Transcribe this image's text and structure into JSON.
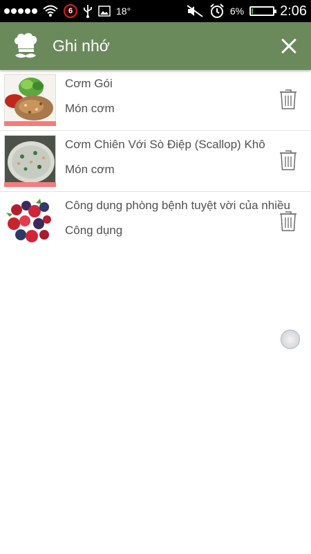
{
  "status_bar": {
    "notification_count": "6",
    "temperature": "18°",
    "battery_percent": "6%",
    "battery_level": 0.06,
    "time": "2:06"
  },
  "app_bar": {
    "title": "Ghi nhớ",
    "logo_icon": "chef-mustache-icon",
    "close_icon": "close-icon"
  },
  "colors": {
    "app_bar": "#6b8a5c",
    "thumb_bar": "#f47c7c",
    "text": "#505050"
  },
  "items": [
    {
      "title": "Cơm Gói",
      "subtitle": "Món cơm",
      "image": "rice-dish-photo",
      "has_bar": true
    },
    {
      "title": "Cơm Chiên Với Sò Điệp (Scallop) Khô",
      "subtitle": "Món cơm",
      "image": "fried-rice-photo",
      "has_bar": true
    },
    {
      "title": "Công dụng phòng bệnh tuyệt vời của nhiều",
      "subtitle": "Công dụng",
      "image": "berries-photo",
      "has_bar": false
    }
  ]
}
